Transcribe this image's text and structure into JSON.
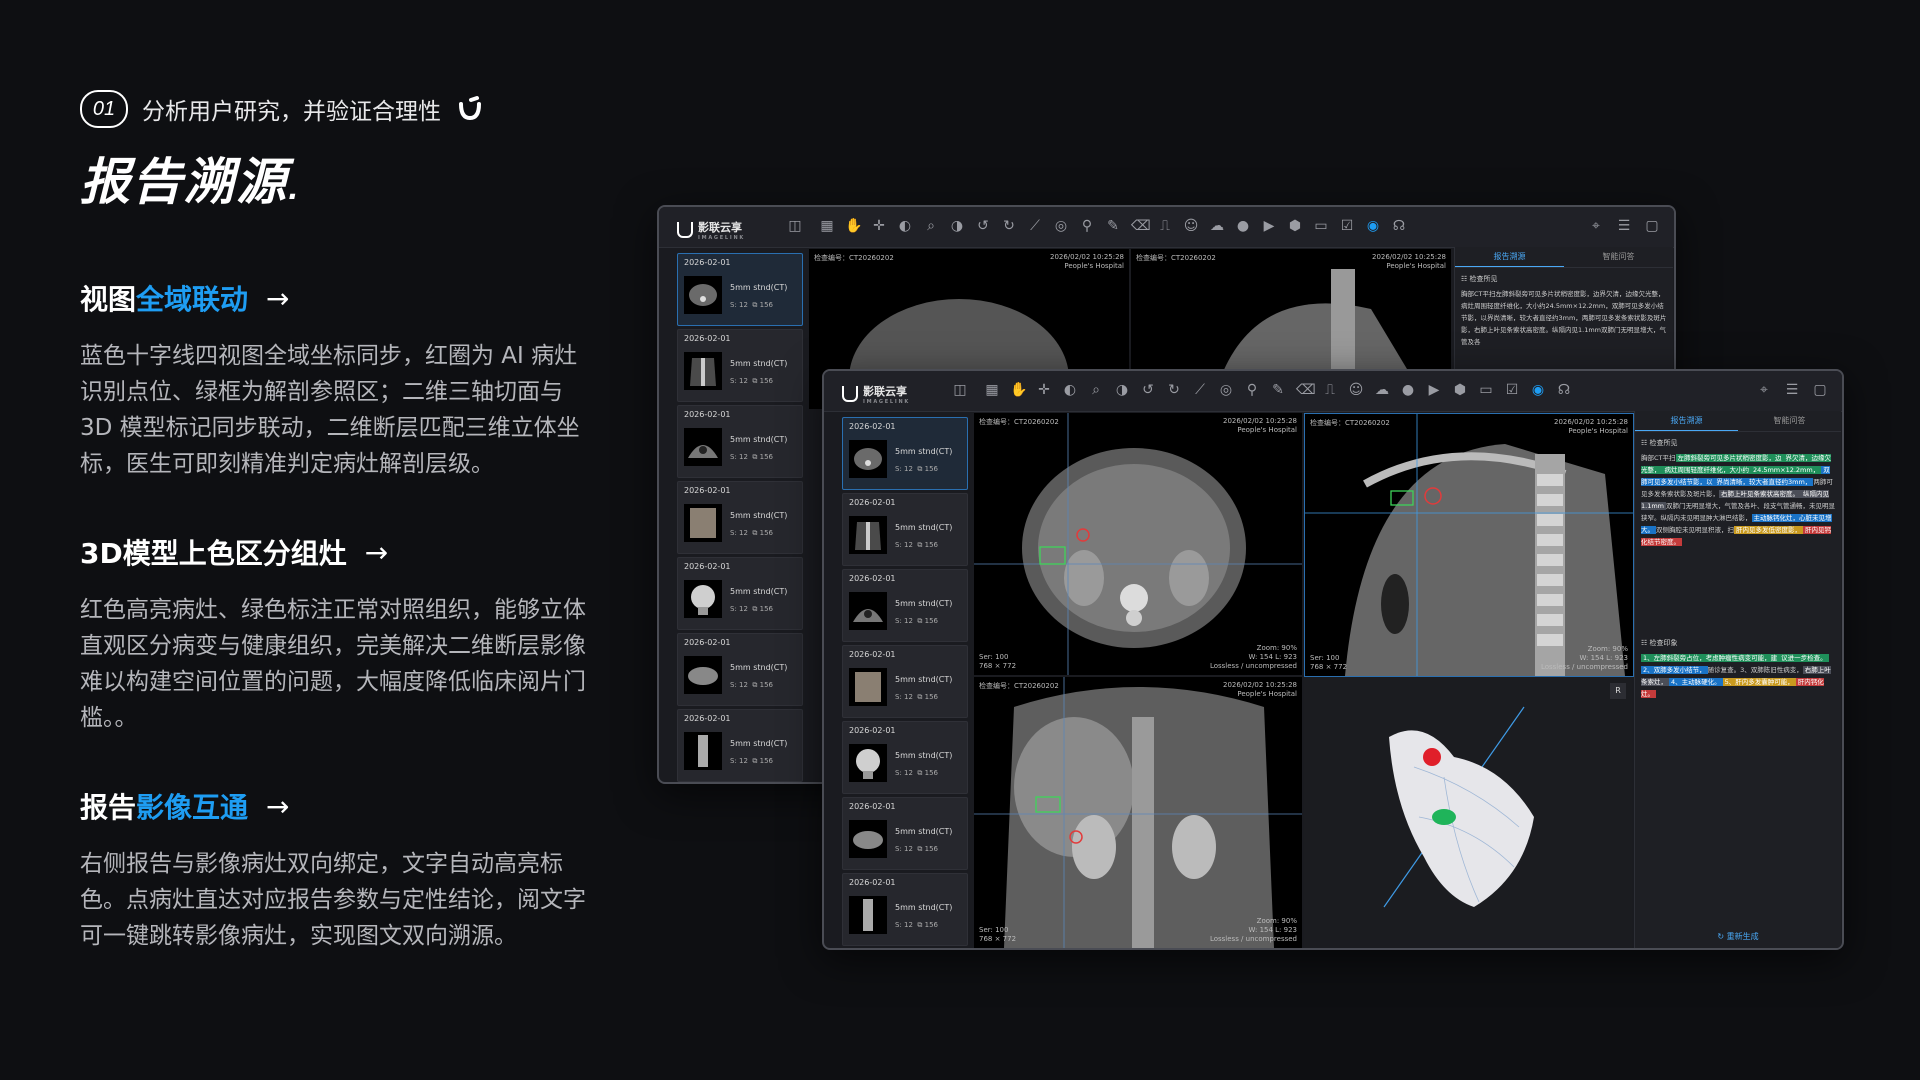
{
  "step": {
    "number": "01",
    "label": "分析用户研究，并验证合理性"
  },
  "title": "报告溯源",
  "sections": [
    {
      "head_pre": "视图",
      "head_hl": "全域联动",
      "head_post": "",
      "arrow": "→",
      "body": "蓝色十字线四视图全域坐标同步，红圈为 AI 病灶识别点位、绿框为解剖参照区；二维三轴切面与 3D 模型标记同步联动，二维断层匹配三维立体坐标，医生可即刻精准判定病灶解剖层级。"
    },
    {
      "head_pre": "3D模型上色区分组灶",
      "head_hl": "",
      "head_post": "",
      "arrow": "→",
      "body": "红色高亮病灶、绿色标注正常对照组织，能够立体直观区分病变与健康组织，完美解决二维断层影像难以构建空间位置的问题，大幅度降低临床阅片门槛。。"
    },
    {
      "head_pre": "报告",
      "head_hl": "影像互通",
      "head_post": "",
      "arrow": "→",
      "body": "右侧报告与影像病灶双向绑定，文字自动高亮标色。点病灶直达对应报告参数与定性结论，阅文字可一键跳转影像病灶，实现图文双向溯源。"
    }
  ],
  "app": {
    "logo": "影联云享",
    "logo_sub": "I M A G E L I N K",
    "series": [
      {
        "date": "2026-02-01",
        "name": "5mm stnd(CT)",
        "s": "S: 12",
        "count": "156"
      },
      {
        "date": "2026-02-01",
        "name": "5mm stnd(CT)",
        "s": "S: 12",
        "count": "156"
      },
      {
        "date": "2026-02-01",
        "name": "5mm stnd(CT)",
        "s": "S: 12",
        "count": "156"
      },
      {
        "date": "2026-02-01",
        "name": "5mm stnd(CT)",
        "s": "S: 12",
        "count": "156"
      },
      {
        "date": "2026-02-01",
        "name": "5mm stnd(CT)",
        "s": "S: 12",
        "count": "156"
      },
      {
        "date": "2026-02-01",
        "name": "5mm stnd(CT)",
        "s": "S: 12",
        "count": "156"
      },
      {
        "date": "2026-02-01",
        "name": "5mm stnd(CT)",
        "s": "S: 12",
        "count": "156"
      }
    ],
    "viewport": {
      "exam_id": "检查编号：CT20260202",
      "datetime": "2026/02/02 10:25:28",
      "hospital": "People's Hospital",
      "ser": "Ser: 100",
      "dims": "768 × 772",
      "zoom": "Zoom: 90%",
      "wl": "W: 154 L: 923",
      "compression": "Lossless / uncompressed",
      "orientation_r": "R"
    },
    "report": {
      "tab_trace": "报告溯源",
      "tab_qa": "智能问答",
      "findings_title": "检查所见",
      "impression_title": "检查印象",
      "regen": "重新生成",
      "f1": "胸部CT平扫",
      "f2": "左肺斜裂旁可见多片状稍密度影，边",
      "f3": "界欠清，边缘欠光整，",
      "f4": "病灶周围轻度纤维化，大小约",
      "f5": "24.5mm×12.2mm，",
      "f6": "双肺可见多发小结节影，以",
      "f7": "界尚清晰，较大者直径约3mm，",
      "f8": "两肺可见多发",
      "f9": "条索状影及斑片影，",
      "f10": "右肺上叶见条索状高密度。",
      "f11": "纵隔内见1.1mm",
      "f12": "双肺门无明显增大，气管及各",
      "f13": "叶、段支气管通畅，未见明显狭窄。",
      "f14": "纵隔内未见",
      "f15": "明显肿大淋巴结影，",
      "f16": "主动脉钙化灶，心脏未见增大。",
      "f17": "双侧胸腔未见明显积液，扫",
      "f18": "肝内见多发低密度影，",
      "f19": "肝内见钙化结节密度。",
      "i1": "1、左肺斜裂旁占位，考虑肿瘤性病变可能，建",
      "i2": "议进一步检查。",
      "i3": "2、双肺多发小结节，",
      "i4": "随诊复查。",
      "i5": "3、双",
      "i6": "肺陈旧性病变，",
      "i7": "右肺上叶条索灶，",
      "i8": "4、主动脉硬化。",
      "i9": "5、肝内多发囊肿可能，",
      "i10": "肝内钙化灶。"
    }
  }
}
